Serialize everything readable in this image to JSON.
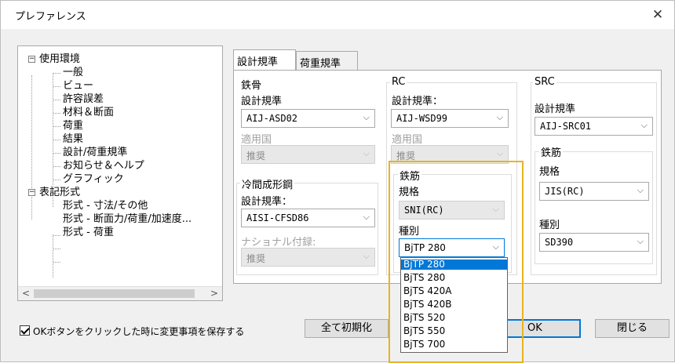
{
  "window": {
    "title": "プレファレンス",
    "close_label": "✕"
  },
  "tree": {
    "nodes": [
      {
        "label": "使用環境",
        "expander": "−"
      },
      {
        "label": "一般"
      },
      {
        "label": "ビュー"
      },
      {
        "label": "許容誤差"
      },
      {
        "label": "材料＆断面"
      },
      {
        "label": "荷重"
      },
      {
        "label": "結果"
      },
      {
        "label": "設計/荷重規準"
      },
      {
        "label": "お知らせ＆ヘルプ"
      },
      {
        "label": "グラフィック"
      },
      {
        "label": "表記形式",
        "expander": "−"
      },
      {
        "label": "形式 - 寸法/その他"
      },
      {
        "label": "形式 - 断面力/荷重/加速度..."
      },
      {
        "label": "形式 - 荷重"
      }
    ],
    "scroll_left": "<",
    "scroll_right": ">"
  },
  "tabs": [
    {
      "label": "設計規準"
    },
    {
      "label": "荷重規準"
    }
  ],
  "steel": {
    "group": "鉄骨",
    "code_label": "設計規準",
    "code_value": "AIJ-ASD02",
    "country_label": "適用国",
    "country_value": "推奨"
  },
  "cold": {
    "group": "冷間成形鋼",
    "code_label": "設計規準：",
    "code_value": "AISI-CFSD86",
    "annex_label": "ナショナル付録:",
    "annex_value": "推奨"
  },
  "rc": {
    "group": "RC",
    "code_label": "設計規準：",
    "code_value": "AIJ-WSD99",
    "country_label": "適用国",
    "country_value": "推奨",
    "rebar_group": "鉄筋",
    "spec_label": "規格",
    "spec_value": "SNI(RC)",
    "grade_label": "種別",
    "grade_value": "BjTP 280",
    "grade_options": [
      "BjTP 280",
      "BjTS 280",
      "BjTS 420A",
      "BjTS 420B",
      "BjTS 520",
      "BjTS 550",
      "BjTS 700"
    ],
    "grade_selected_index": 0
  },
  "src": {
    "group": "SRC",
    "code_label": "設計規準",
    "code_value": "AIJ-SRC01",
    "rebar_group": "鉄筋",
    "spec_label": "規格",
    "spec_value": "JIS(RC)",
    "grade_label": "種別",
    "grade_value": "SD390"
  },
  "footer": {
    "checkbox_label": "OKボタンをクリックした時に変更事項を保存する",
    "checkbox_checked": true,
    "reset_button": "全て初期化",
    "ok_button": "OK",
    "close_button": "閉じる"
  },
  "colors": {
    "selection": "#0078d7",
    "highlight_box": "#e8b420"
  }
}
